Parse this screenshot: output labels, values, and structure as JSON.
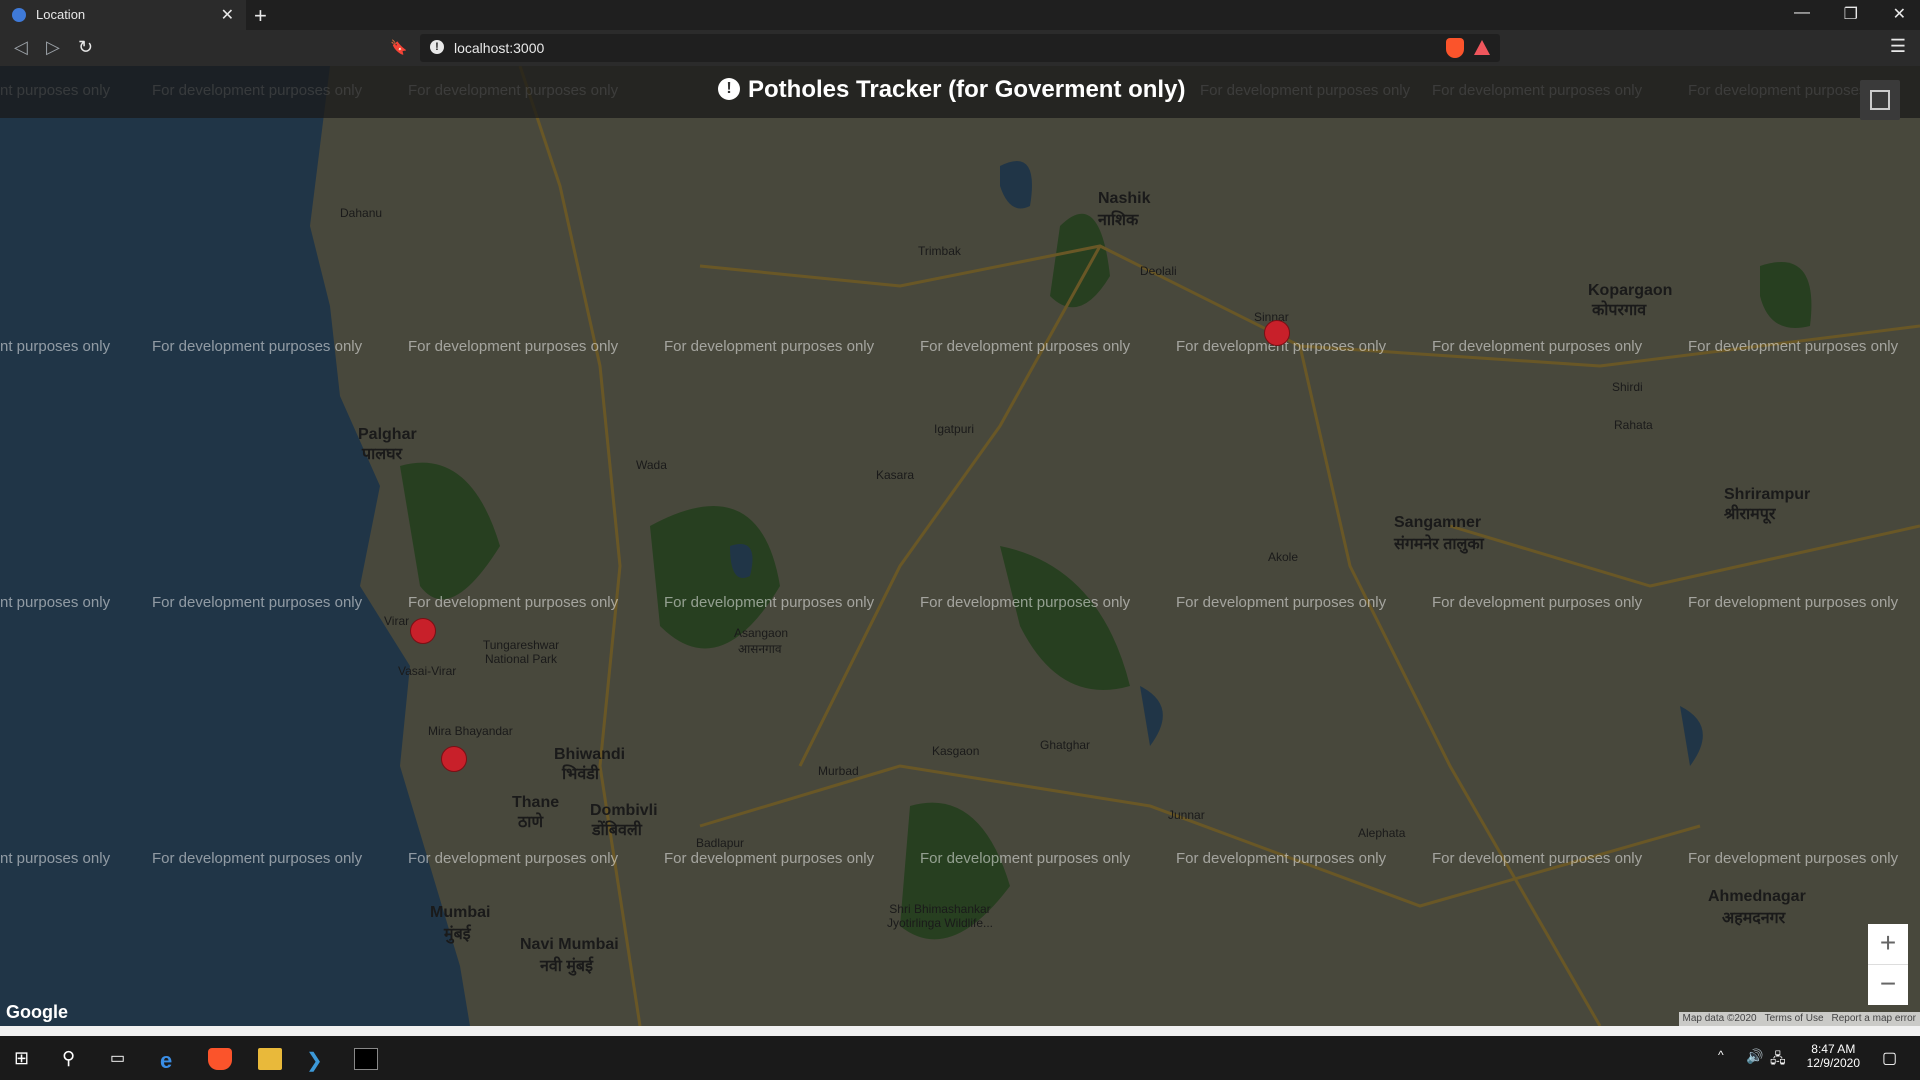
{
  "browser": {
    "tab_title": "Location",
    "url": "localhost:3000"
  },
  "app": {
    "title": "Potholes Tracker (for Goverment only)"
  },
  "map": {
    "watermark": "For development purposes only",
    "watermark_partial": "nt purposes only",
    "places": [
      {
        "name": "Nashik",
        "big": true
      },
      {
        "name": "नाशिक",
        "big": true
      },
      {
        "name": "Mumbai",
        "big": true
      },
      {
        "name": "मुंबई",
        "big": true
      },
      {
        "name": "Navi Mumbai",
        "big": true
      },
      {
        "name": "नवी मुंबई",
        "big": true
      },
      {
        "name": "Thane",
        "big": true
      },
      {
        "name": "ठाणे",
        "big": true
      },
      {
        "name": "Bhiwandi",
        "big": true
      },
      {
        "name": "भिवंडी",
        "big": true
      },
      {
        "name": "Dombivli",
        "big": true
      },
      {
        "name": "डोंबिवली",
        "big": true
      },
      {
        "name": "Sangamner",
        "big": true
      },
      {
        "name": "संगमनेर तालुका",
        "big": true
      },
      {
        "name": "Ahmednagar",
        "big": true
      },
      {
        "name": "अहमदनगर",
        "big": true
      },
      {
        "name": "Shrirampur",
        "big": true
      },
      {
        "name": "श्रीरामपूर",
        "big": true
      },
      {
        "name": "Kopargaon",
        "big": true
      },
      {
        "name": "कोपरगाव",
        "big": true
      },
      {
        "name": "Tungareshwar National Park",
        "big": false
      },
      {
        "name": "Palghar",
        "big": true
      },
      {
        "name": "पालघर",
        "big": true
      },
      {
        "name": "Vasai-Virar",
        "big": false
      },
      {
        "name": "Virar",
        "big": false
      },
      {
        "name": "Mira Bhayandar",
        "big": false
      },
      {
        "name": "Asangaon",
        "big": false
      },
      {
        "name": "आसनगाव",
        "big": false
      },
      {
        "name": "Igatpuri",
        "big": false
      },
      {
        "name": "Sinnar",
        "big": false
      },
      {
        "name": "Deolali",
        "big": false
      },
      {
        "name": "Dahanu",
        "big": false
      },
      {
        "name": "Rahata",
        "big": false
      },
      {
        "name": "Shirdi",
        "big": false
      },
      {
        "name": "Shri Bhimashankar Jyotirlinga Wildlife...",
        "big": false
      },
      {
        "name": "Junnar",
        "big": false
      },
      {
        "name": "Akole",
        "big": false
      },
      {
        "name": "Kasara",
        "big": false
      },
      {
        "name": "Trimbak",
        "big": false
      },
      {
        "name": "Wada",
        "big": false
      },
      {
        "name": "Badlapur",
        "big": false
      },
      {
        "name": "Alephata",
        "big": false
      },
      {
        "name": "Ghatghar",
        "big": false
      },
      {
        "name": "Murbad",
        "big": false
      },
      {
        "name": "Kasgaon",
        "big": false
      }
    ],
    "markers_count": 3,
    "zoom_in": "+",
    "zoom_out": "−",
    "logo": "Google",
    "attribution": {
      "data": "Map data ©2020",
      "terms": "Terms of Use",
      "report": "Report a map error"
    }
  },
  "taskbar": {
    "time": "8:47 AM",
    "date": "12/9/2020"
  },
  "colors": {
    "marker": "#c8202a",
    "water": "#3f6788",
    "land": "#8b8b73",
    "forest": "#4c7a3e"
  }
}
